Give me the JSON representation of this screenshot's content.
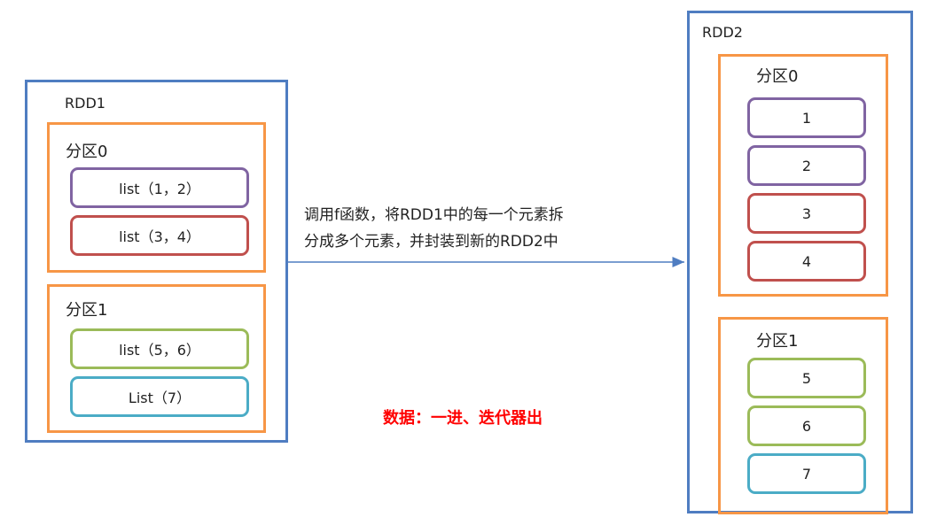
{
  "rdd1": {
    "label": "RDD1",
    "partitions": [
      {
        "label": "分区0",
        "elements": [
          "list（1，2）",
          "list（3，4）"
        ]
      },
      {
        "label": "分区1",
        "elements": [
          "list（5，6）",
          "List（7）"
        ]
      }
    ]
  },
  "rdd2": {
    "label": "RDD2",
    "partitions": [
      {
        "label": "分区0",
        "elements": [
          "1",
          "2",
          "3",
          "4"
        ]
      },
      {
        "label": "分区1",
        "elements": [
          "5",
          "6",
          "7"
        ]
      }
    ]
  },
  "description": {
    "line1": "调用f函数，将RDD1中的每一个元素拆",
    "line2": "分成多个元素，并封装到新的RDD2中"
  },
  "note": {
    "text": "数据：一进、迭代器出",
    "color": "#ff0000"
  },
  "colors": {
    "rdd_border": "#4f7dc1",
    "partition_border": "#f79646",
    "arrow": "#4f7dc1",
    "purple": "#8064a2",
    "red": "#c0504d",
    "green": "#9bbb59",
    "cyan": "#4bacc6"
  }
}
